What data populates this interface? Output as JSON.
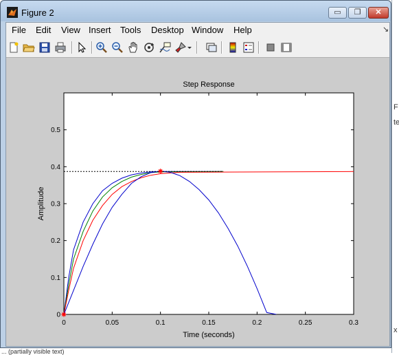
{
  "window": {
    "title": "Figure 2",
    "min_label": "▭",
    "max_label": "❐",
    "close_label": "✕"
  },
  "menu": [
    "File",
    "Edit",
    "View",
    "Insert",
    "Tools",
    "Desktop",
    "Window",
    "Help"
  ],
  "dock_arrow": "↘",
  "toolbar_icons": [
    "new-figure-icon",
    "open-file-icon",
    "save-icon",
    "print-icon",
    "edit-plot-icon",
    "zoom-in-icon",
    "zoom-out-icon",
    "pan-icon",
    "rotate-3d-icon",
    "data-cursor-icon",
    "brush-icon",
    "brush-dropdown-icon",
    "link-plot-icon",
    "insert-colorbar-icon",
    "insert-legend-icon",
    "hide-plot-tools-icon",
    "show-plot-tools-icon"
  ],
  "background_fragments": {
    "frag1": "F",
    "frag2": "te",
    "frag3": "x",
    "bottom": "... (partially visible text)"
  },
  "chart_data": {
    "type": "line",
    "title": "Step Response",
    "xlabel": "Time (seconds)",
    "ylabel": "Amplitude",
    "xlim": [
      0,
      0.3
    ],
    "ylim": [
      0,
      0.6
    ],
    "xticks": [
      "0",
      "0.05",
      "0.1",
      "0.15",
      "0.2",
      "0.25",
      "0.3"
    ],
    "yticks": [
      "0",
      "0.1",
      "0.2",
      "0.3",
      "0.4",
      "0.5"
    ],
    "steady_state": 0.387,
    "marker": {
      "x": 0.1,
      "y": 0.388,
      "color": "#ff0000"
    },
    "origin_marker": {
      "x": 0,
      "y": 0,
      "color": "#ff0000"
    },
    "colors": {
      "blue": "#0000cc",
      "green": "#008000",
      "red": "#ff0000",
      "black": "#000000"
    },
    "series": [
      {
        "color": "#0000cc",
        "points": [
          [
            0,
            0
          ],
          [
            0.005,
            0.1
          ],
          [
            0.01,
            0.175
          ],
          [
            0.02,
            0.25
          ],
          [
            0.03,
            0.3
          ],
          [
            0.04,
            0.335
          ],
          [
            0.05,
            0.355
          ],
          [
            0.06,
            0.369
          ],
          [
            0.07,
            0.378
          ],
          [
            0.08,
            0.383
          ],
          [
            0.09,
            0.386
          ],
          [
            0.1,
            0.387
          ],
          [
            0.165,
            0.387
          ]
        ]
      },
      {
        "color": "#008000",
        "points": [
          [
            0,
            0
          ],
          [
            0.005,
            0.08
          ],
          [
            0.01,
            0.15
          ],
          [
            0.02,
            0.225
          ],
          [
            0.03,
            0.28
          ],
          [
            0.04,
            0.318
          ],
          [
            0.05,
            0.343
          ],
          [
            0.06,
            0.36
          ],
          [
            0.07,
            0.372
          ],
          [
            0.08,
            0.379
          ],
          [
            0.09,
            0.384
          ],
          [
            0.1,
            0.386
          ],
          [
            0.165,
            0.387
          ]
        ]
      },
      {
        "color": "#ff0000",
        "points": [
          [
            0,
            0
          ],
          [
            0.005,
            0.065
          ],
          [
            0.01,
            0.125
          ],
          [
            0.02,
            0.2
          ],
          [
            0.03,
            0.255
          ],
          [
            0.04,
            0.295
          ],
          [
            0.05,
            0.325
          ],
          [
            0.06,
            0.346
          ],
          [
            0.07,
            0.36
          ],
          [
            0.08,
            0.37
          ],
          [
            0.09,
            0.377
          ],
          [
            0.1,
            0.381
          ],
          [
            0.12,
            0.385
          ],
          [
            0.3,
            0.387
          ]
        ]
      },
      {
        "color": "#0000cc",
        "points": [
          [
            0,
            0
          ],
          [
            0.01,
            0.065
          ],
          [
            0.02,
            0.13
          ],
          [
            0.03,
            0.19
          ],
          [
            0.04,
            0.245
          ],
          [
            0.05,
            0.29
          ],
          [
            0.06,
            0.325
          ],
          [
            0.07,
            0.355
          ],
          [
            0.08,
            0.373
          ],
          [
            0.09,
            0.384
          ],
          [
            0.1,
            0.388
          ],
          [
            0.11,
            0.385
          ],
          [
            0.12,
            0.376
          ],
          [
            0.13,
            0.36
          ],
          [
            0.14,
            0.338
          ],
          [
            0.15,
            0.31
          ],
          [
            0.16,
            0.275
          ],
          [
            0.17,
            0.233
          ],
          [
            0.18,
            0.185
          ],
          [
            0.19,
            0.13
          ],
          [
            0.2,
            0.07
          ],
          [
            0.21,
            0.005
          ],
          [
            0.22,
            0
          ]
        ]
      },
      {
        "color": "#000000",
        "dashed": true,
        "points": [
          [
            0,
            0.387
          ],
          [
            0.165,
            0.387
          ]
        ]
      }
    ]
  }
}
